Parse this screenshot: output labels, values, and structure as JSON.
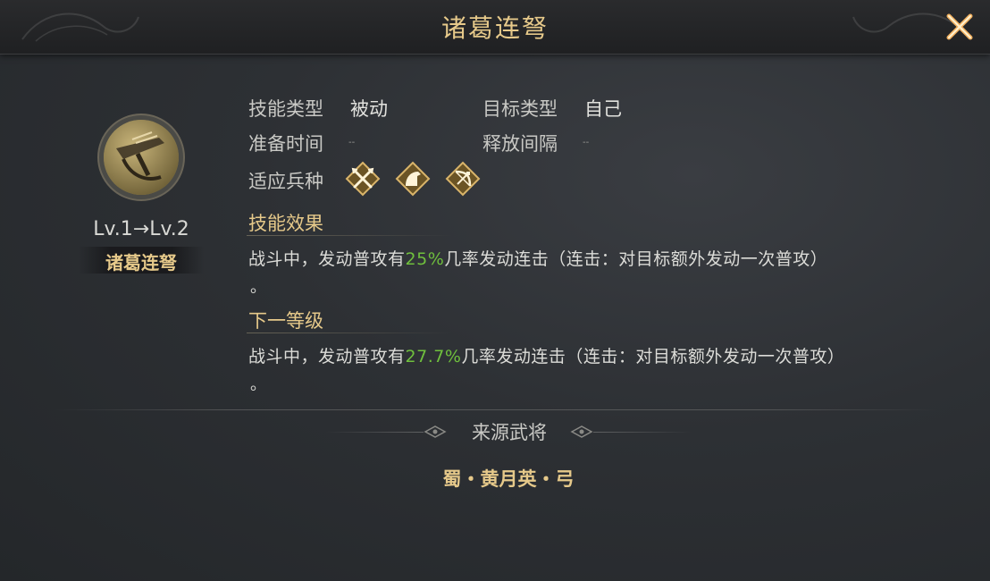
{
  "window": {
    "title": "诸葛连弩"
  },
  "skill": {
    "icon": "crossbow-icon",
    "level_text": "Lv.1→Lv.2",
    "name": "诸葛连弩",
    "skill_type_label": "技能类型",
    "skill_type_value": "被动",
    "target_type_label": "目标类型",
    "target_type_value": "自己",
    "prep_time_label": "准备时间",
    "prep_time_value": "--",
    "release_interval_label": "释放间隔",
    "release_interval_value": "--",
    "troop_label": "适应兵种",
    "troops": [
      {
        "icon": "spear-troop-icon"
      },
      {
        "icon": "cavalry-troop-icon"
      },
      {
        "icon": "archer-troop-icon"
      }
    ]
  },
  "effect": {
    "title": "技能效果",
    "text_before": "战斗中，发动普攻有",
    "percent": "25%",
    "text_after": "几率发动连击（连击：对目标额外发动一次普攻）",
    "end": "。"
  },
  "next_level": {
    "title": "下一等级",
    "text_before": "战斗中，发动普攻有",
    "percent": "27.7%",
    "text_after": "几率发动连击（连击：对目标额外发动一次普攻）",
    "end": "。"
  },
  "source": {
    "title": "来源武将",
    "general": "蜀・黄月英・弓"
  },
  "colors": {
    "accent_gold": "#e6c98a",
    "highlight_green": "#6fbf3d",
    "close_orange": "#e8a040"
  }
}
